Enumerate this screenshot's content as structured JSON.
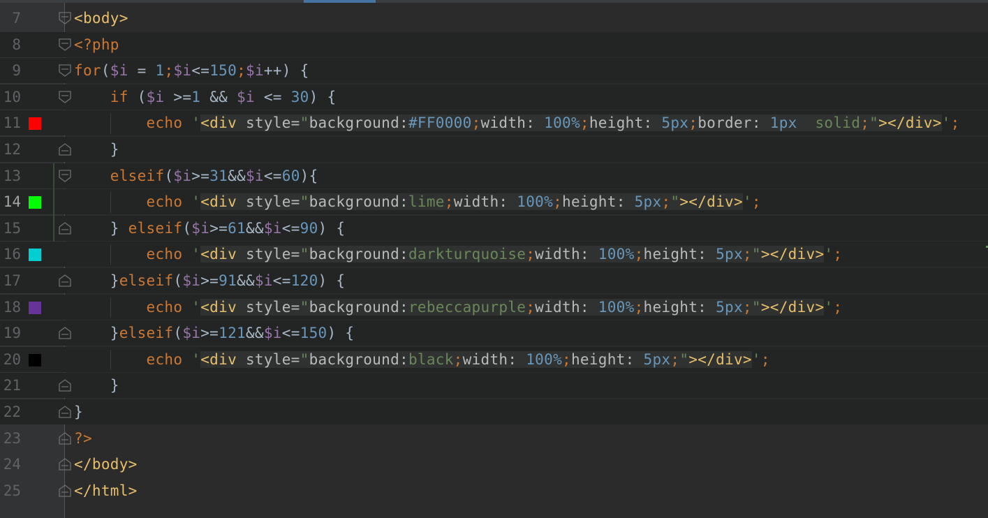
{
  "editor": {
    "lines": [
      {
        "number": "7",
        "current": false,
        "swatch": null,
        "fold": "open",
        "segments": [
          {
            "t": "<body>",
            "c": "tag"
          }
        ]
      },
      {
        "number": "8",
        "current": false,
        "swatch": null,
        "fold": "open",
        "segments": [
          {
            "t": "<?php",
            "c": "kw"
          }
        ]
      },
      {
        "number": "9",
        "current": false,
        "swatch": null,
        "fold": "open",
        "segments": [
          {
            "t": "for",
            "c": "kw"
          },
          {
            "t": "(",
            "c": "plain"
          },
          {
            "t": "$i",
            "c": "var"
          },
          {
            "t": " = ",
            "c": "plain"
          },
          {
            "t": "1",
            "c": "num"
          },
          {
            "t": ";",
            "c": "kw"
          },
          {
            "t": "$i",
            "c": "var"
          },
          {
            "t": "<=",
            "c": "plain"
          },
          {
            "t": "150",
            "c": "num"
          },
          {
            "t": ";",
            "c": "kw"
          },
          {
            "t": "$i",
            "c": "var"
          },
          {
            "t": "++) {",
            "c": "plain"
          }
        ]
      },
      {
        "number": "10",
        "current": false,
        "swatch": null,
        "fold": "open",
        "segments": [
          {
            "t": "    ",
            "c": "plain"
          },
          {
            "t": "if",
            "c": "kw"
          },
          {
            "t": " (",
            "c": "plain"
          },
          {
            "t": "$i",
            "c": "var"
          },
          {
            "t": " >=",
            "c": "plain"
          },
          {
            "t": "1",
            "c": "num"
          },
          {
            "t": " && ",
            "c": "plain"
          },
          {
            "t": "$i",
            "c": "var"
          },
          {
            "t": " <= ",
            "c": "plain"
          },
          {
            "t": "30",
            "c": "num"
          },
          {
            "t": ") {",
            "c": "plain"
          }
        ]
      },
      {
        "number": "11",
        "current": false,
        "swatch": "#FF0000",
        "fold": "none",
        "segments": [
          {
            "t": "        ",
            "c": "plain"
          },
          {
            "t": "echo",
            "c": "kw"
          },
          {
            "t": " ",
            "c": "plain"
          },
          {
            "t": "'",
            "c": "strq"
          },
          {
            "t": "<div",
            "c": "tag",
            "inj": true
          },
          {
            "t": " style=",
            "c": "attr",
            "inj": true
          },
          {
            "t": "\"",
            "c": "strq",
            "inj": true
          },
          {
            "t": "background:",
            "c": "css-prop",
            "inj": true
          },
          {
            "t": "#FF0000",
            "c": "num",
            "inj": true
          },
          {
            "t": ";",
            "c": "kw",
            "inj": true
          },
          {
            "t": "width: ",
            "c": "css-prop",
            "inj": true
          },
          {
            "t": "100%",
            "c": "num",
            "inj": true
          },
          {
            "t": ";",
            "c": "kw",
            "inj": true
          },
          {
            "t": "height: ",
            "c": "css-prop",
            "inj": true
          },
          {
            "t": "5px",
            "c": "num",
            "inj": true
          },
          {
            "t": ";",
            "c": "kw",
            "inj": true
          },
          {
            "t": "border: ",
            "c": "css-prop",
            "inj": true
          },
          {
            "t": "1px  ",
            "c": "num",
            "inj": true
          },
          {
            "t": "solid",
            "c": "val",
            "inj": true
          },
          {
            "t": ";",
            "c": "kw",
            "inj": true
          },
          {
            "t": "\"",
            "c": "strq",
            "inj": true
          },
          {
            "t": "></div>",
            "c": "tag",
            "inj": true
          },
          {
            "t": "'",
            "c": "strq"
          },
          {
            "t": ";",
            "c": "kw"
          }
        ]
      },
      {
        "number": "12",
        "current": false,
        "swatch": null,
        "fold": "close",
        "segments": [
          {
            "t": "    }",
            "c": "plain"
          }
        ]
      },
      {
        "number": "13",
        "current": false,
        "swatch": null,
        "fold": "open",
        "segments": [
          {
            "t": "    ",
            "c": "plain"
          },
          {
            "t": "elseif",
            "c": "kw"
          },
          {
            "t": "(",
            "c": "plain"
          },
          {
            "t": "$i",
            "c": "var"
          },
          {
            "t": ">=",
            "c": "plain"
          },
          {
            "t": "31",
            "c": "num"
          },
          {
            "t": "&&",
            "c": "plain"
          },
          {
            "t": "$i",
            "c": "var"
          },
          {
            "t": "<=",
            "c": "plain"
          },
          {
            "t": "60",
            "c": "num"
          },
          {
            "t": "){",
            "c": "plain"
          }
        ]
      },
      {
        "number": "14",
        "current": true,
        "swatch": "#00FF00",
        "fold": "none",
        "segments": [
          {
            "t": "        ",
            "c": "plain"
          },
          {
            "t": "echo",
            "c": "kw"
          },
          {
            "t": " ",
            "c": "plain"
          },
          {
            "t": "'",
            "c": "strq"
          },
          {
            "t": "<div",
            "c": "tag",
            "inj": true
          },
          {
            "t": " style=",
            "c": "attr",
            "inj": true
          },
          {
            "t": "\"",
            "c": "strq",
            "inj": true
          },
          {
            "t": "background:",
            "c": "css-prop",
            "inj": true
          },
          {
            "t": "lime",
            "c": "val",
            "inj": true
          },
          {
            "t": ";",
            "c": "kw",
            "inj": true
          },
          {
            "t": "width: ",
            "c": "css-prop",
            "inj": true
          },
          {
            "t": "100%",
            "c": "num",
            "inj": true
          },
          {
            "t": ";",
            "c": "kw",
            "inj": true
          },
          {
            "t": "height",
            "c": "css-prop",
            "inj": true,
            "hl": true
          },
          {
            "t": ": ",
            "c": "css-prop",
            "inj": true
          },
          {
            "t": "5px",
            "c": "num",
            "inj": true
          },
          {
            "t": ";",
            "c": "kw",
            "inj": true
          },
          {
            "t": "\"",
            "c": "strq",
            "inj": true
          },
          {
            "t": "></div>",
            "c": "tag",
            "inj": true
          },
          {
            "t": "'",
            "c": "strq"
          },
          {
            "t": ";",
            "c": "kw"
          }
        ]
      },
      {
        "number": "15",
        "current": false,
        "swatch": null,
        "fold": "close",
        "segments": [
          {
            "t": "    } ",
            "c": "plain"
          },
          {
            "t": "elseif",
            "c": "kw"
          },
          {
            "t": "(",
            "c": "plain"
          },
          {
            "t": "$i",
            "c": "var"
          },
          {
            "t": ">=",
            "c": "plain"
          },
          {
            "t": "61",
            "c": "num"
          },
          {
            "t": "&&",
            "c": "plain"
          },
          {
            "t": "$i",
            "c": "var"
          },
          {
            "t": "<=",
            "c": "plain"
          },
          {
            "t": "90",
            "c": "num"
          },
          {
            "t": ") {",
            "c": "plain"
          }
        ]
      },
      {
        "number": "16",
        "current": false,
        "swatch": "#00CED1",
        "fold": "none",
        "segments": [
          {
            "t": "        ",
            "c": "plain"
          },
          {
            "t": "echo",
            "c": "kw"
          },
          {
            "t": " ",
            "c": "plain"
          },
          {
            "t": "'",
            "c": "strq"
          },
          {
            "t": "<div",
            "c": "tag",
            "inj": true
          },
          {
            "t": " style=",
            "c": "attr",
            "inj": true
          },
          {
            "t": "\"",
            "c": "strq",
            "inj": true
          },
          {
            "t": "background:",
            "c": "css-prop",
            "inj": true
          },
          {
            "t": "darkturquoise",
            "c": "val",
            "inj": true
          },
          {
            "t": ";",
            "c": "kw",
            "inj": true
          },
          {
            "t": "width: ",
            "c": "css-prop",
            "inj": true
          },
          {
            "t": "100%",
            "c": "num",
            "inj": true
          },
          {
            "t": ";",
            "c": "kw",
            "inj": true
          },
          {
            "t": "height: ",
            "c": "css-prop",
            "inj": true
          },
          {
            "t": "5px",
            "c": "num",
            "inj": true
          },
          {
            "t": ";",
            "c": "kw",
            "inj": true
          },
          {
            "t": "\"",
            "c": "strq",
            "inj": true
          },
          {
            "t": "></div>",
            "c": "tag",
            "inj": true
          },
          {
            "t": "'",
            "c": "strq"
          },
          {
            "t": ";",
            "c": "kw"
          }
        ]
      },
      {
        "number": "17",
        "current": false,
        "swatch": null,
        "fold": "close",
        "segments": [
          {
            "t": "    }",
            "c": "plain"
          },
          {
            "t": "elseif",
            "c": "kw"
          },
          {
            "t": "(",
            "c": "plain"
          },
          {
            "t": "$i",
            "c": "var"
          },
          {
            "t": ">=",
            "c": "plain"
          },
          {
            "t": "91",
            "c": "num"
          },
          {
            "t": "&&",
            "c": "plain"
          },
          {
            "t": "$i",
            "c": "var"
          },
          {
            "t": "<=",
            "c": "plain"
          },
          {
            "t": "120",
            "c": "num"
          },
          {
            "t": ") {",
            "c": "plain"
          }
        ]
      },
      {
        "number": "18",
        "current": false,
        "swatch": "#663399",
        "fold": "none",
        "segments": [
          {
            "t": "        ",
            "c": "plain"
          },
          {
            "t": "echo",
            "c": "kw"
          },
          {
            "t": " ",
            "c": "plain"
          },
          {
            "t": "'",
            "c": "strq"
          },
          {
            "t": "<div",
            "c": "tag",
            "inj": true
          },
          {
            "t": " style=",
            "c": "attr",
            "inj": true
          },
          {
            "t": "\"",
            "c": "strq",
            "inj": true
          },
          {
            "t": "background:",
            "c": "css-prop",
            "inj": true
          },
          {
            "t": "rebeccapurple",
            "c": "val",
            "inj": true
          },
          {
            "t": ";",
            "c": "kw",
            "inj": true
          },
          {
            "t": "width: ",
            "c": "css-prop",
            "inj": true
          },
          {
            "t": "100%",
            "c": "num",
            "inj": true
          },
          {
            "t": ";",
            "c": "kw",
            "inj": true
          },
          {
            "t": "height: ",
            "c": "css-prop",
            "inj": true
          },
          {
            "t": "5px",
            "c": "num",
            "inj": true
          },
          {
            "t": ";",
            "c": "kw",
            "inj": true
          },
          {
            "t": "\"",
            "c": "strq",
            "inj": true
          },
          {
            "t": "></div>",
            "c": "tag",
            "inj": true
          },
          {
            "t": "'",
            "c": "strq"
          },
          {
            "t": ";",
            "c": "kw"
          }
        ]
      },
      {
        "number": "19",
        "current": false,
        "swatch": null,
        "fold": "close",
        "segments": [
          {
            "t": "    }",
            "c": "plain"
          },
          {
            "t": "elseif",
            "c": "kw"
          },
          {
            "t": "(",
            "c": "plain"
          },
          {
            "t": "$i",
            "c": "var"
          },
          {
            "t": ">=",
            "c": "plain"
          },
          {
            "t": "121",
            "c": "num"
          },
          {
            "t": "&&",
            "c": "plain"
          },
          {
            "t": "$i",
            "c": "var"
          },
          {
            "t": "<=",
            "c": "plain"
          },
          {
            "t": "150",
            "c": "num"
          },
          {
            "t": ") {",
            "c": "plain"
          }
        ]
      },
      {
        "number": "20",
        "current": false,
        "swatch": "#000000",
        "fold": "none",
        "segments": [
          {
            "t": "        ",
            "c": "plain"
          },
          {
            "t": "echo",
            "c": "kw"
          },
          {
            "t": " ",
            "c": "plain"
          },
          {
            "t": "'",
            "c": "strq"
          },
          {
            "t": "<div",
            "c": "tag",
            "inj": true
          },
          {
            "t": " style=",
            "c": "attr",
            "inj": true
          },
          {
            "t": "\"",
            "c": "strq",
            "inj": true
          },
          {
            "t": "background:",
            "c": "css-prop",
            "inj": true
          },
          {
            "t": "black",
            "c": "val",
            "inj": true
          },
          {
            "t": ";",
            "c": "kw",
            "inj": true
          },
          {
            "t": "width: ",
            "c": "css-prop",
            "inj": true
          },
          {
            "t": "100%",
            "c": "num",
            "inj": true
          },
          {
            "t": ";",
            "c": "kw",
            "inj": true
          },
          {
            "t": "height: ",
            "c": "css-prop",
            "inj": true
          },
          {
            "t": "5px",
            "c": "num",
            "inj": true
          },
          {
            "t": ";",
            "c": "kw",
            "inj": true
          },
          {
            "t": "\"",
            "c": "strq",
            "inj": true
          },
          {
            "t": "></div>",
            "c": "tag",
            "inj": true
          },
          {
            "t": "'",
            "c": "strq"
          },
          {
            "t": ";",
            "c": "kw"
          }
        ]
      },
      {
        "number": "21",
        "current": false,
        "swatch": null,
        "fold": "close",
        "segments": [
          {
            "t": "    }",
            "c": "plain"
          }
        ]
      },
      {
        "number": "22",
        "current": false,
        "swatch": null,
        "fold": "close",
        "segments": [
          {
            "t": "}",
            "c": "plain"
          }
        ]
      },
      {
        "number": "23",
        "current": false,
        "swatch": null,
        "fold": "close",
        "segments": [
          {
            "t": "?>",
            "c": "kw"
          }
        ]
      },
      {
        "number": "24",
        "current": false,
        "swatch": null,
        "fold": "close",
        "segments": [
          {
            "t": "</body>",
            "c": "tag"
          }
        ]
      },
      {
        "number": "25",
        "current": false,
        "swatch": null,
        "fold": "close",
        "segments": [
          {
            "t": "</html>",
            "c": "tag"
          }
        ]
      }
    ]
  },
  "colors": {
    "background": "#2b2b2b",
    "gutter": "#313335",
    "keyword": "#cc7832",
    "variable": "#9876aa",
    "number": "#6897bb",
    "tag": "#e8bf6a",
    "string": "#6a8759",
    "selection": "#214283"
  }
}
